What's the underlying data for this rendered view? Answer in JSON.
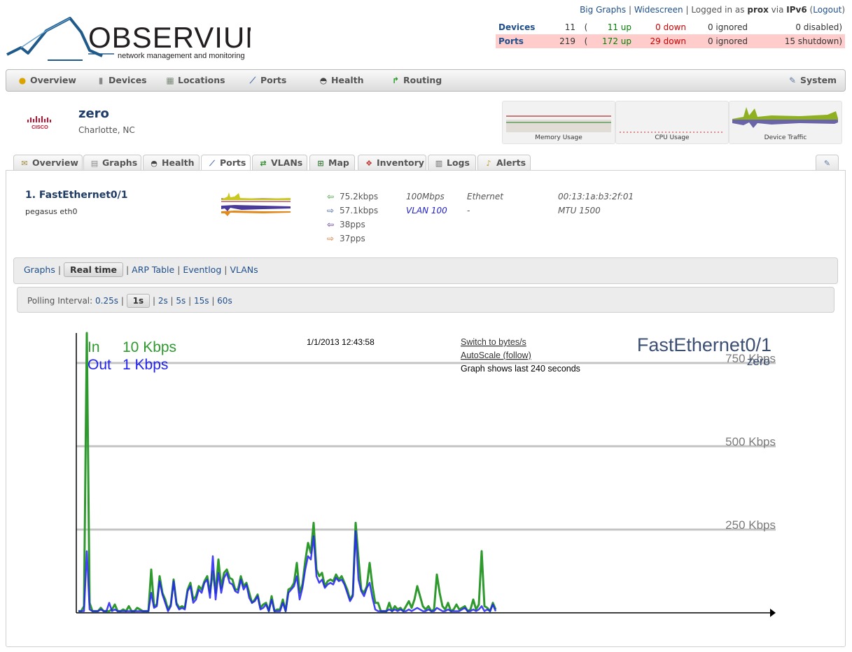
{
  "top_links": {
    "big_graphs": "Big Graphs",
    "sep1": " | ",
    "widescreen": "Widescreen",
    "logged_prefix": " | Logged in as ",
    "user": "prox",
    "via": " via ",
    "proto": "IPv6",
    "logout_open": " (",
    "logout": "Logout",
    "logout_close": ")"
  },
  "logo": {
    "word": "OBSERVIUM",
    "tagline": "network management and monitoring"
  },
  "status": {
    "devices": {
      "label": "Devices",
      "total": "11",
      "paren": "(",
      "up": "11 up",
      "down": "0 down",
      "ignored": "0 ignored",
      "extra": "0 disabled)"
    },
    "ports": {
      "label": "Ports",
      "total": "219",
      "paren": "(",
      "up": "172 up",
      "down": "29 down",
      "ignored": "0 ignored",
      "extra": "15 shutdown)"
    }
  },
  "nav": {
    "overview": "Overview",
    "devices": "Devices",
    "locations": "Locations",
    "ports": "Ports",
    "health": "Health",
    "routing": "Routing",
    "system": "System"
  },
  "device": {
    "name": "zero",
    "location": "Charlotte, NC",
    "vendor_logo": "CISCO",
    "thumbs": {
      "memory": "Memory Usage",
      "cpu": "CPU Usage",
      "traffic": "Device Traffic"
    }
  },
  "tabs": {
    "overview": "Overview",
    "graphs": "Graphs",
    "health": "Health",
    "ports": "Ports",
    "vlans": "VLANs",
    "map": "Map",
    "inventory": "Inventory",
    "logs": "Logs",
    "alerts": "Alerts"
  },
  "port": {
    "name": "1. FastEthernet0/1",
    "desc": "pegasus eth0",
    "in_rate": "75.2kbps",
    "out_rate": "57.1kbps",
    "in_pps": "38pps",
    "out_pps": "37pps",
    "speed": "100Mbps",
    "vlan": "VLAN 100",
    "type": "Ethernet",
    "type_sub": "-",
    "mac": "00:13:1a:b3:2f:01",
    "mtu": "MTU 1500"
  },
  "subnav": {
    "graphs": "Graphs",
    "realtime": "Real time",
    "arp": "ARP Table",
    "eventlog": "Eventlog",
    "vlans": "VLANs",
    "sep": " | "
  },
  "polling": {
    "label": "Polling Interval:",
    "options": [
      "0.25s",
      "1s",
      "2s",
      "5s",
      "15s",
      "60s"
    ],
    "selected": "1s"
  },
  "realtime": {
    "in_label": "In",
    "in_value": "10 Kbps",
    "out_label": "Out",
    "out_value": "1 Kbps",
    "timestamp": "1/1/2013 12:43:58",
    "switch_link": "Switch to bytes/s",
    "autoscale_link": "AutoScale (follow)",
    "shows": "Graph shows last 240 seconds",
    "port_title": "FastEthernet0/1",
    "device_title": "zero"
  },
  "chart_data": {
    "type": "line",
    "ylim": [
      0,
      840
    ],
    "gridlines": [
      250,
      750,
      500
    ],
    "gridline_labels": [
      "250 Kbps",
      "750 Kbps",
      "500 Kbps"
    ],
    "grid": true,
    "colors": {
      "in": "#2e9a2e",
      "out": "#2222ee"
    },
    "series": [
      {
        "name": "In",
        "values": [
          5,
          5,
          20,
          840,
          30,
          5,
          5,
          5,
          15,
          5,
          5,
          5,
          10,
          25,
          5,
          5,
          10,
          5,
          20,
          5,
          5,
          15,
          10,
          5,
          5,
          5,
          130,
          20,
          25,
          110,
          60,
          40,
          10,
          25,
          100,
          30,
          15,
          20,
          15,
          70,
          90,
          40,
          50,
          80,
          70,
          95,
          110,
          60,
          125,
          60,
          160,
          75,
          120,
          130,
          105,
          100,
          70,
          70,
          110,
          80,
          90,
          60,
          30,
          40,
          55,
          15,
          25,
          30,
          5,
          50,
          5,
          10,
          10,
          40,
          5,
          70,
          75,
          90,
          150,
          60,
          85,
          155,
          210,
          180,
          270,
          130,
          110,
          120,
          80,
          95,
          100,
          95,
          115,
          100,
          110,
          90,
          70,
          40,
          55,
          270,
          165,
          70,
          60,
          80,
          150,
          80,
          30,
          30,
          5,
          5,
          5,
          30,
          5,
          20,
          10,
          15,
          5,
          20,
          35,
          15,
          40,
          80,
          50,
          20,
          10,
          20,
          5,
          10,
          115,
          60,
          20,
          10,
          30,
          5,
          10,
          25,
          10,
          15,
          20,
          5,
          10,
          40,
          10,
          25,
          185,
          20,
          15,
          5,
          30,
          10
        ]
      },
      {
        "name": "Out",
        "values": [
          5,
          5,
          5,
          185,
          10,
          5,
          5,
          5,
          10,
          5,
          5,
          30,
          5,
          10,
          5,
          5,
          5,
          5,
          5,
          5,
          5,
          5,
          5,
          5,
          5,
          5,
          60,
          15,
          20,
          95,
          55,
          30,
          5,
          20,
          95,
          25,
          10,
          15,
          10,
          65,
          80,
          30,
          40,
          70,
          60,
          90,
          100,
          45,
          170,
          40,
          120,
          60,
          105,
          120,
          90,
          85,
          65,
          60,
          100,
          70,
          85,
          45,
          30,
          35,
          50,
          10,
          15,
          25,
          5,
          40,
          5,
          5,
          5,
          30,
          5,
          60,
          70,
          80,
          110,
          40,
          75,
          130,
          170,
          160,
          230,
          110,
          90,
          100,
          75,
          85,
          90,
          85,
          105,
          95,
          100,
          85,
          60,
          35,
          50,
          245,
          100,
          65,
          50,
          75,
          90,
          45,
          10,
          5,
          5,
          5,
          5,
          10,
          5,
          10,
          5,
          10,
          5,
          5,
          10,
          5,
          10,
          15,
          10,
          5,
          5,
          10,
          5,
          5,
          15,
          10,
          5,
          5,
          10,
          5,
          5,
          5,
          5,
          10,
          15,
          5,
          5,
          10,
          5,
          10,
          20,
          5,
          10,
          5,
          25,
          5
        ]
      }
    ]
  }
}
